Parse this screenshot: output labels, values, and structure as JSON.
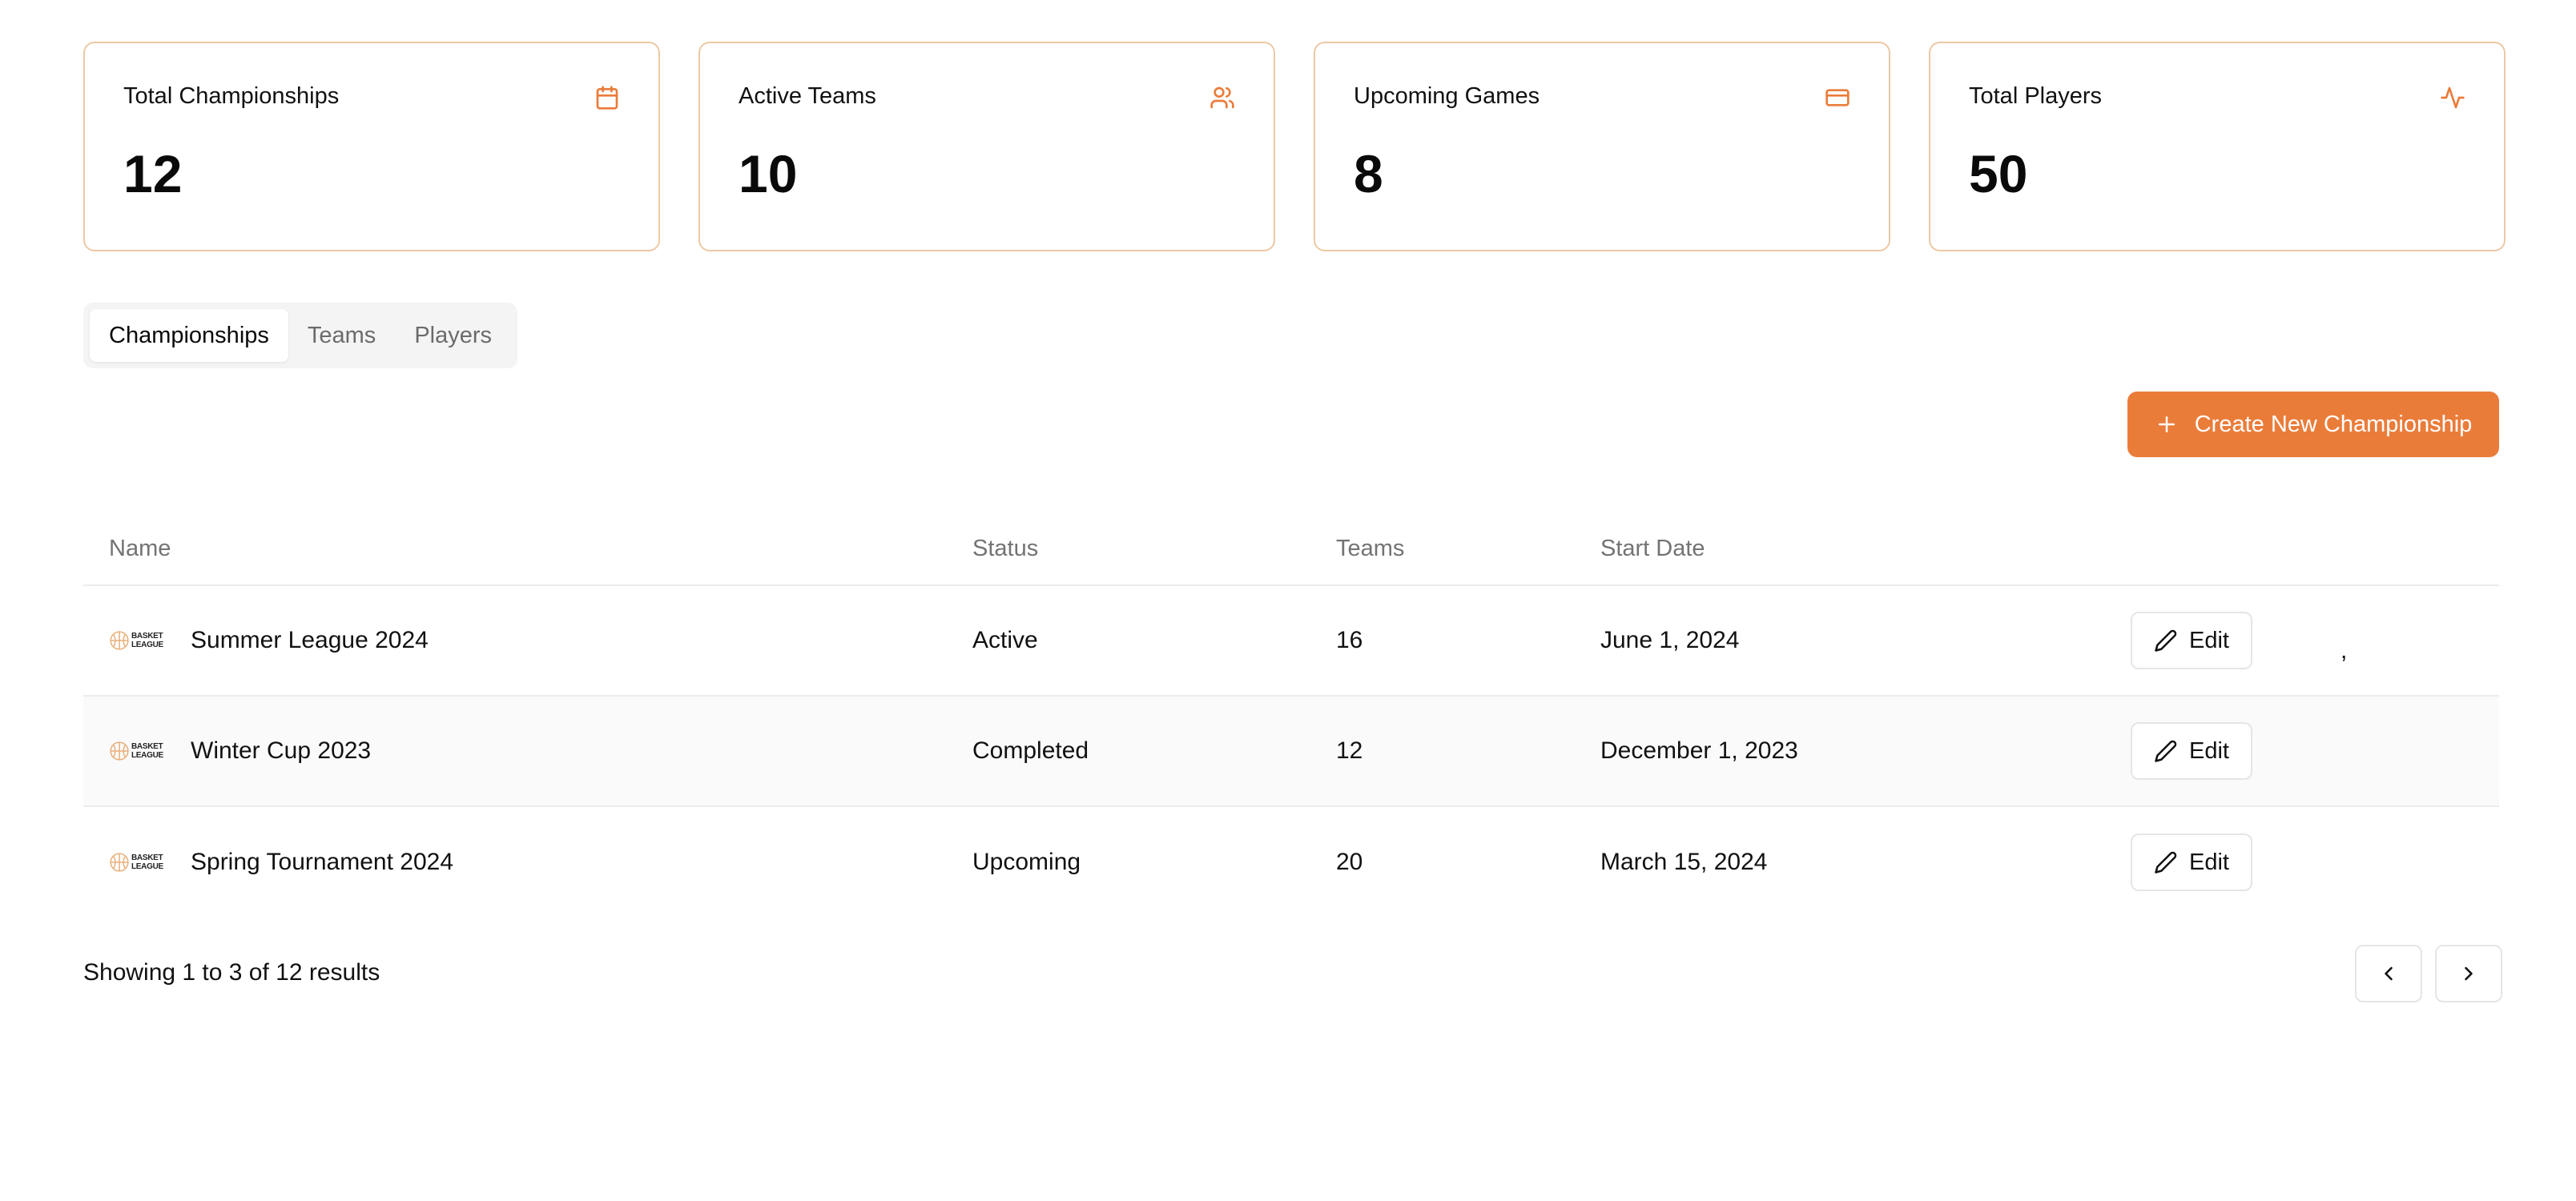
{
  "stats": [
    {
      "title": "Total Championships",
      "value": "12",
      "icon": "calendar-icon"
    },
    {
      "title": "Active Teams",
      "value": "10",
      "icon": "users-icon"
    },
    {
      "title": "Upcoming Games",
      "value": "8",
      "icon": "credit-card-icon"
    },
    {
      "title": "Total Players",
      "value": "50",
      "icon": "activity-icon"
    }
  ],
  "tabs": [
    {
      "label": "Championships",
      "active": true
    },
    {
      "label": "Teams",
      "active": false
    },
    {
      "label": "Players",
      "active": false
    }
  ],
  "create_button": {
    "label": "Create New Championship",
    "icon": "plus-icon"
  },
  "table": {
    "headers": {
      "name": "Name",
      "status": "Status",
      "teams": "Teams",
      "start_date": "Start Date"
    },
    "rows": [
      {
        "logo_lines": [
          "BASKET",
          "LEAGUE"
        ],
        "name": "Summer League 2024",
        "status": "Active",
        "teams": "16",
        "start_date": "June 1, 2024",
        "action": "Edit"
      },
      {
        "logo_lines": [
          "BASKET",
          "LEAGUE"
        ],
        "name": "Winter Cup 2023",
        "status": "Completed",
        "teams": "12",
        "start_date": "December 1, 2023",
        "action": "Edit"
      },
      {
        "logo_lines": [
          "BASKET",
          "LEAGUE"
        ],
        "name": "Spring Tournament 2024",
        "status": "Upcoming",
        "teams": "20",
        "start_date": "March 15, 2024",
        "action": "Edit"
      }
    ],
    "stray_text": ","
  },
  "footer": {
    "results_text": "Showing 1 to 3 of 12 results"
  },
  "colors": {
    "accent": "#ea7c3a",
    "card_border": "#ecc9a5"
  }
}
